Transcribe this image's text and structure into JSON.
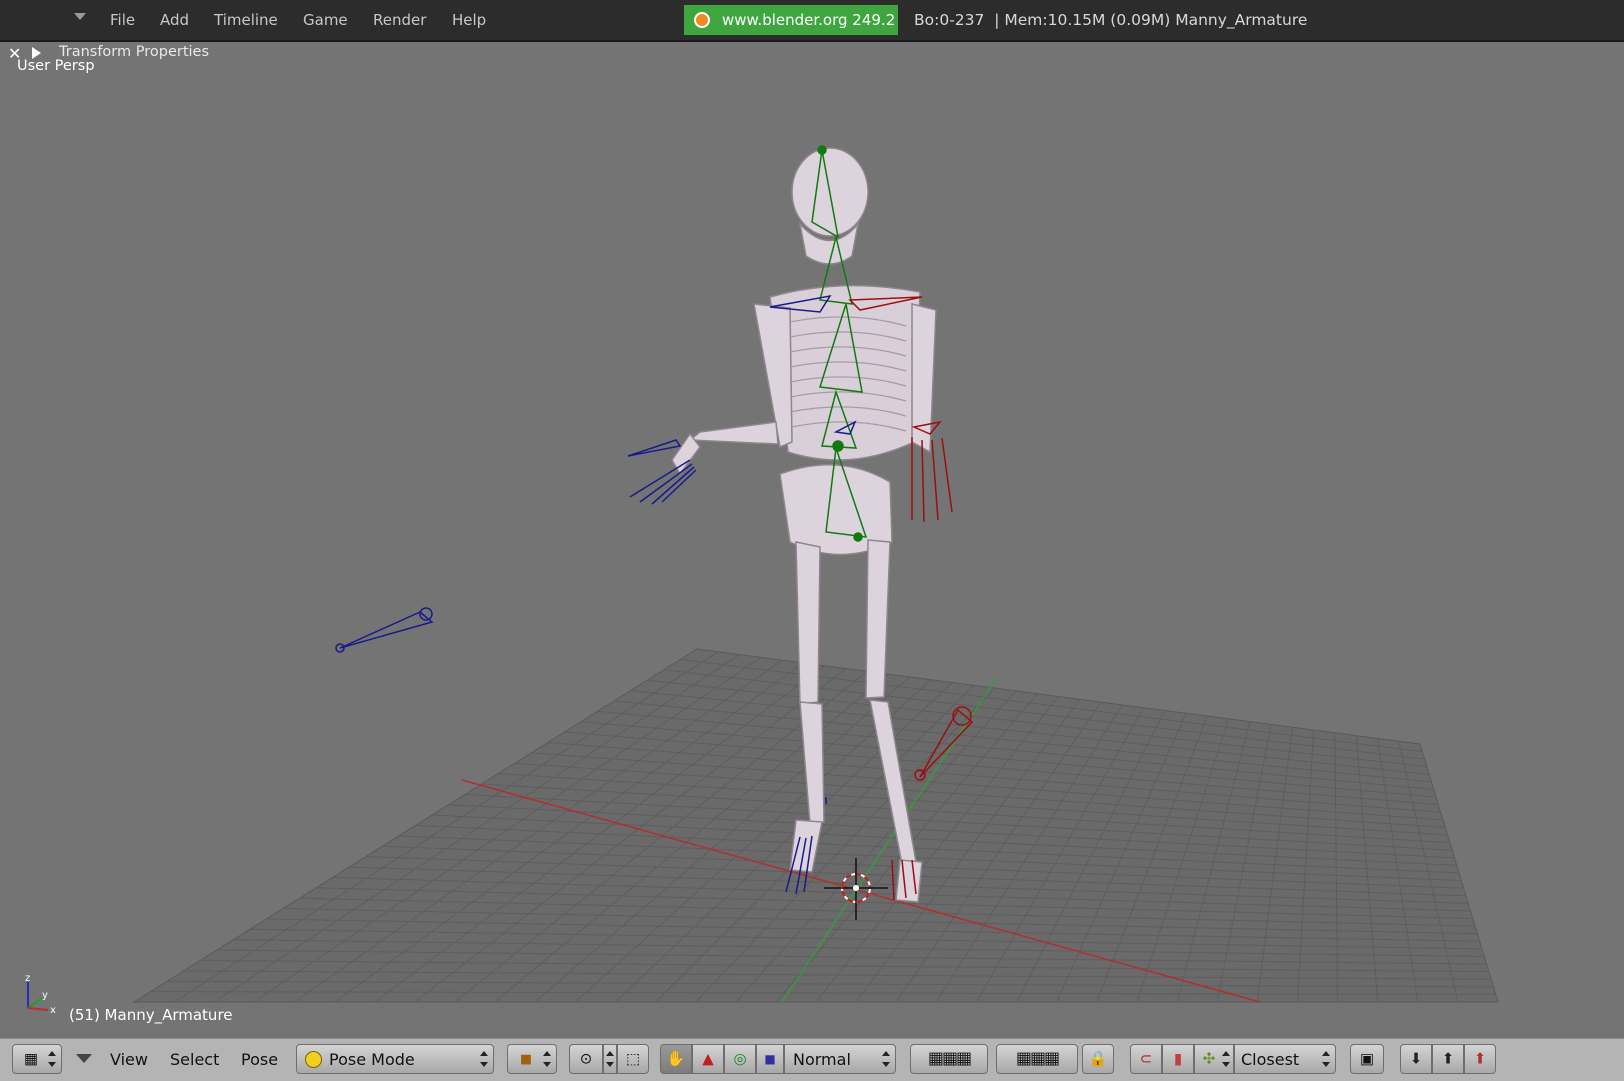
{
  "top_menu": {
    "items": [
      "File",
      "Add",
      "Timeline",
      "Game",
      "Render",
      "Help"
    ],
    "site_badge": "www.blender.org 249.2",
    "stats": "Bo:0-237  | Mem:10.15M (0.09M) Manny_Armature"
  },
  "viewport": {
    "panel_title": "Transform Properties",
    "view_label": "User Persp",
    "object_label": "(51) Manny_Armature",
    "axis_labels": {
      "z": "z",
      "y": "y",
      "x": "x"
    }
  },
  "bottom_bar": {
    "menus": [
      "View",
      "Select",
      "Pose"
    ],
    "mode": "Pose Mode",
    "orientation": "Normal",
    "snap_target": "Closest"
  },
  "colors": {
    "viewport_bg": "#747474",
    "grid": "#5e5e5e",
    "x_axis": "#b03030",
    "y_axis": "#3a9a3a",
    "bone_left": "#1a1a8a",
    "bone_right": "#9a1010",
    "bone_spine": "#107a10"
  }
}
